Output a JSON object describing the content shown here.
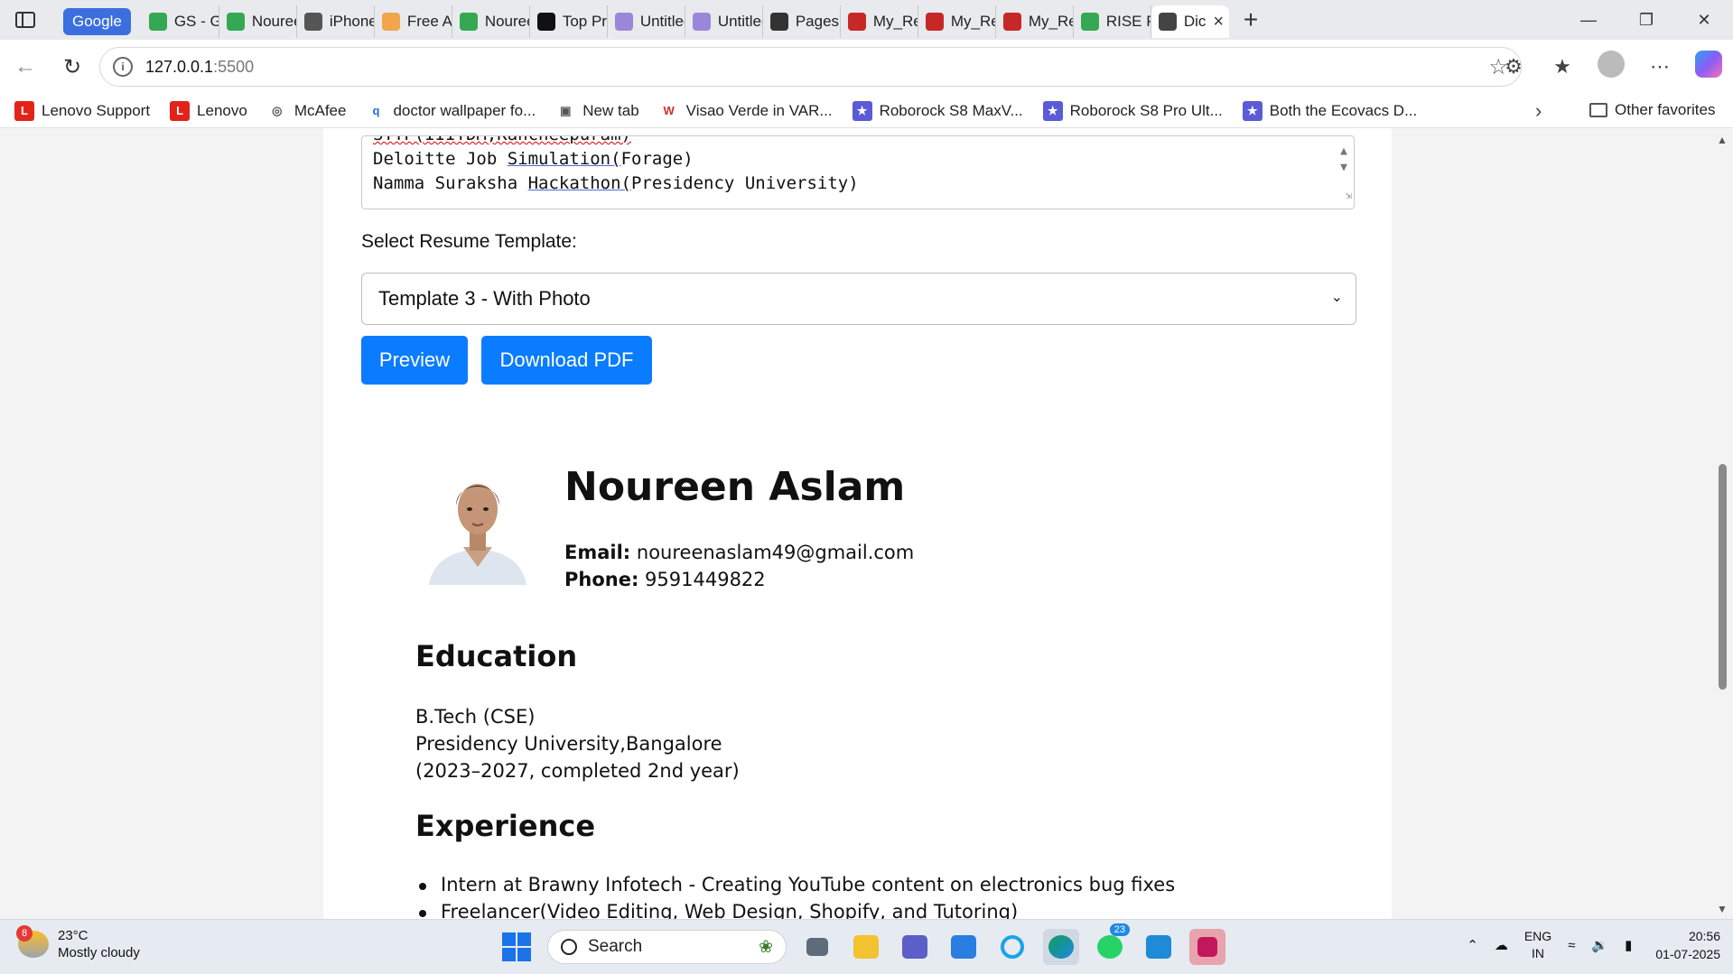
{
  "browser": {
    "tabs": [
      {
        "label": "Google",
        "kind": "group"
      },
      {
        "label": "GS - Go",
        "icon": "drive-icon",
        "color": "#34a853"
      },
      {
        "label": "Nouree",
        "icon": "sheets-icon",
        "color": "#34a853"
      },
      {
        "label": "iPhone I",
        "icon": "openai-icon",
        "color": "#555555"
      },
      {
        "label": "Free AI",
        "icon": "a-icon",
        "color": "#f2a54a"
      },
      {
        "label": "Nouree",
        "icon": "sheets-icon",
        "color": "#34a853"
      },
      {
        "label": "Top Pro",
        "icon": "openai-icon",
        "color": "#111111"
      },
      {
        "label": "Untitled",
        "icon": "canva-icon",
        "color": "#9b87d9"
      },
      {
        "label": "Untitled",
        "icon": "canva-icon",
        "color": "#9b87d9"
      },
      {
        "label": "Pages",
        "icon": "github-icon",
        "color": "#333333"
      },
      {
        "label": "My_Res",
        "icon": "pdf-icon",
        "color": "#c62828"
      },
      {
        "label": "My_Res",
        "icon": "pdf-icon",
        "color": "#c62828"
      },
      {
        "label": "My_Res",
        "icon": "pdf-icon",
        "color": "#c62828"
      },
      {
        "label": "RISE Pro",
        "icon": "drive-icon",
        "color": "#34a853"
      },
      {
        "label": "Dic",
        "icon": "globe-icon",
        "color": "#444444",
        "active": true
      }
    ],
    "address": {
      "host": "127.0.0.1",
      "port": ":5500"
    },
    "favorites": [
      {
        "label": "Lenovo Support",
        "icon": "lenovo-icon",
        "color": "#e2231a",
        "glyph": "L"
      },
      {
        "label": "Lenovo",
        "icon": "lenovo-icon",
        "color": "#e2231a",
        "glyph": "L"
      },
      {
        "label": "McAfee",
        "icon": "globe-icon",
        "color": "#555555",
        "glyph": "◎"
      },
      {
        "label": "doctor wallpaper fo...",
        "icon": "search-icon",
        "color": "#1a73e8",
        "glyph": "q"
      },
      {
        "label": "New tab",
        "icon": "newtab-icon",
        "color": "#555555",
        "glyph": "▣"
      },
      {
        "label": "Visao Verde in VAR...",
        "icon": "visao-icon",
        "color": "#d32f2f",
        "glyph": "W"
      },
      {
        "label": "Roborock S8 MaxV...",
        "icon": "roborock-icon",
        "color": "#5b5bd6",
        "glyph": "★"
      },
      {
        "label": "Roborock S8 Pro Ult...",
        "icon": "roborock-icon",
        "color": "#5b5bd6",
        "glyph": "★"
      },
      {
        "label": "Both the Ecovacs D...",
        "icon": "roborock-icon",
        "color": "#5b5bd6",
        "glyph": "★"
      }
    ],
    "other_favorites": "Other favorites"
  },
  "form": {
    "textarea_lines": [
      "STTP(IIITDM,Kancheepuram)",
      "Deloitte Job Simulation(Forage)",
      "Namma Suraksha Hackathon(Presidency University)"
    ],
    "select_label": "Select Resume Template:",
    "select_value": "Template 3 - With Photo",
    "preview_button": "Preview",
    "download_button": "Download PDF",
    "accent": "#0a7cff"
  },
  "resume": {
    "name": "Noureen Aslam",
    "email_label": "Email:",
    "email": "noureenaslam49@gmail.com",
    "phone_label": "Phone:",
    "phone": "9591449822",
    "education_heading": "Education",
    "education": [
      "B.Tech (CSE)",
      "Presidency University,Bangalore",
      "(2023–2027, completed 2nd year)"
    ],
    "experience_heading": "Experience",
    "experience": [
      "Intern at Brawny Infotech - Creating YouTube content on electronics bug fixes",
      "Freelancer(Video Editing, Web Design, Shopify, and Tutoring)"
    ]
  },
  "taskbar": {
    "weather_temp": "23°C",
    "weather_desc": "Mostly cloudy",
    "weather_badge": "8",
    "search_placeholder": "Search",
    "whatsapp_badge": "23",
    "lang_top": "ENG",
    "lang_bottom": "IN",
    "time": "20:56",
    "date": "01-07-2025"
  }
}
